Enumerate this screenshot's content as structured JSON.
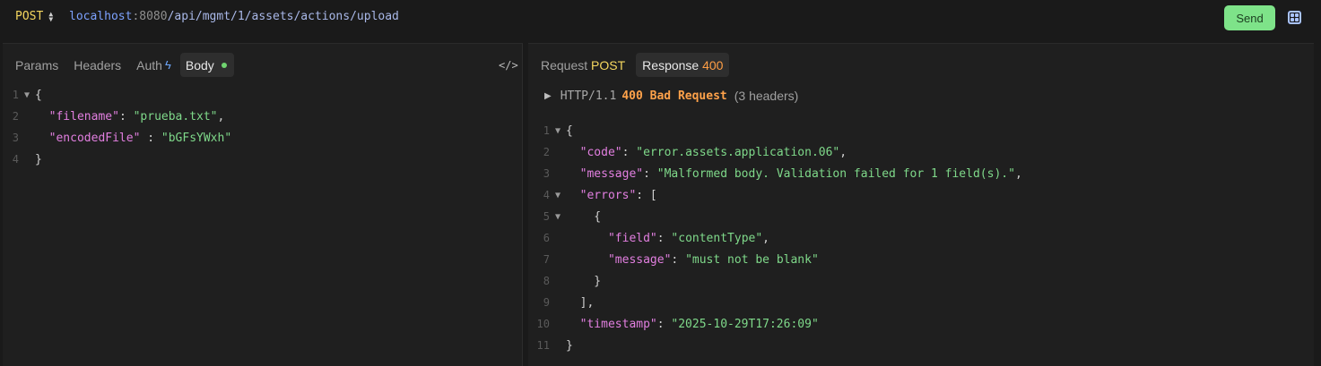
{
  "request": {
    "method": "POST",
    "url_host": "localhost",
    "url_port": ":8080",
    "url_path": "/api/mgmt/1/assets/actions/upload",
    "send_label": "Send"
  },
  "left_tabs": {
    "params": "Params",
    "headers": "Headers",
    "auth": "Auth",
    "body": "Body"
  },
  "request_body_lines": [
    {
      "n": "1",
      "fold": true
    },
    {
      "n": "2"
    },
    {
      "n": "3"
    },
    {
      "n": "4"
    }
  ],
  "request_body": {
    "open": "{",
    "filename_key": "\"filename\"",
    "filename_val": "\"prueba.txt\"",
    "encoded_key": "\"encodedFile\"",
    "encoded_val": "\"bGFsYWxh\"",
    "close": "}"
  },
  "right_tabs": {
    "request_label": "Request",
    "request_method": "POST",
    "response_label": "Response",
    "response_code": "400"
  },
  "status": {
    "protocol": "HTTP/1.1",
    "code_text": "400 Bad Request",
    "headers_count": "(3 headers)"
  },
  "response_body": {
    "code_key": "\"code\"",
    "code_val": "\"error.assets.application.06\"",
    "message_key": "\"message\"",
    "message_val": "\"Malformed body. Validation failed for 1 field(s).\"",
    "errors_key": "\"errors\"",
    "field_key": "\"field\"",
    "field_val": "\"contentType\"",
    "err_message_key": "\"message\"",
    "err_message_val": "\"must not be blank\"",
    "timestamp_key": "\"timestamp\"",
    "timestamp_val": "\"2025-10-29T17:26:09\""
  },
  "colors": {
    "method": "#f5d75f",
    "send_bg": "#7ee389",
    "key": "#e27fe0",
    "string": "#7fd98a",
    "error_status": "#ffa24a"
  }
}
